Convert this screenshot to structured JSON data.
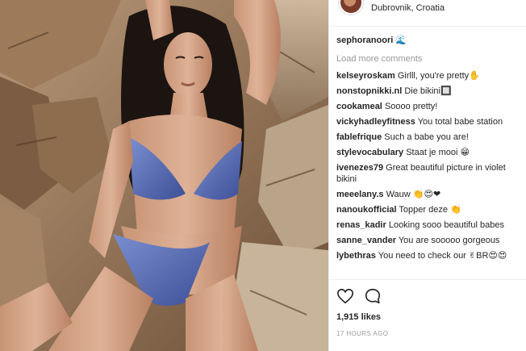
{
  "post": {
    "location": "Dubrovnik, Croatia",
    "likes": "1,915 likes",
    "timestamp": "17 HOURS AGO"
  },
  "owner_comment": {
    "username": "sephoranoori",
    "emoji": "🌊"
  },
  "load_more_label": "Load more comments",
  "comments": [
    {
      "username": "kelseyroskam",
      "text": "Girlll, you're pretty✋"
    },
    {
      "username": "nonstopnikki.nl",
      "text": "Die bikini🔲"
    },
    {
      "username": "cookameal",
      "text": "Soooo pretty!"
    },
    {
      "username": "vickyhadleyfitness",
      "text": "You total babe station"
    },
    {
      "username": "fablefrique",
      "text": "Such a babe you are!"
    },
    {
      "username": "stylevocabulary",
      "text": "Staat je mooi 😁"
    },
    {
      "username": "ivenezes79",
      "text": "Great beautiful picture in violet bikini"
    },
    {
      "username": "meeelany.s",
      "text": "Wauw 👏😍❤"
    },
    {
      "username": "nanoukofficial",
      "text": "Topper deze 👏"
    },
    {
      "username": "renas_kadir",
      "text": "Looking sooo beautiful babes"
    },
    {
      "username": "sanne_vander",
      "text": "You are sooooo gorgeous"
    },
    {
      "username": "lybethras",
      "text": "You need to check our ✌BR😍😍"
    }
  ],
  "colors": {
    "border": "#efefef",
    "muted": "#999999",
    "text": "#262626",
    "accent": "#3897f0"
  },
  "icons": {
    "like": "heart-outline-icon",
    "comment": "speech-bubble-icon"
  }
}
